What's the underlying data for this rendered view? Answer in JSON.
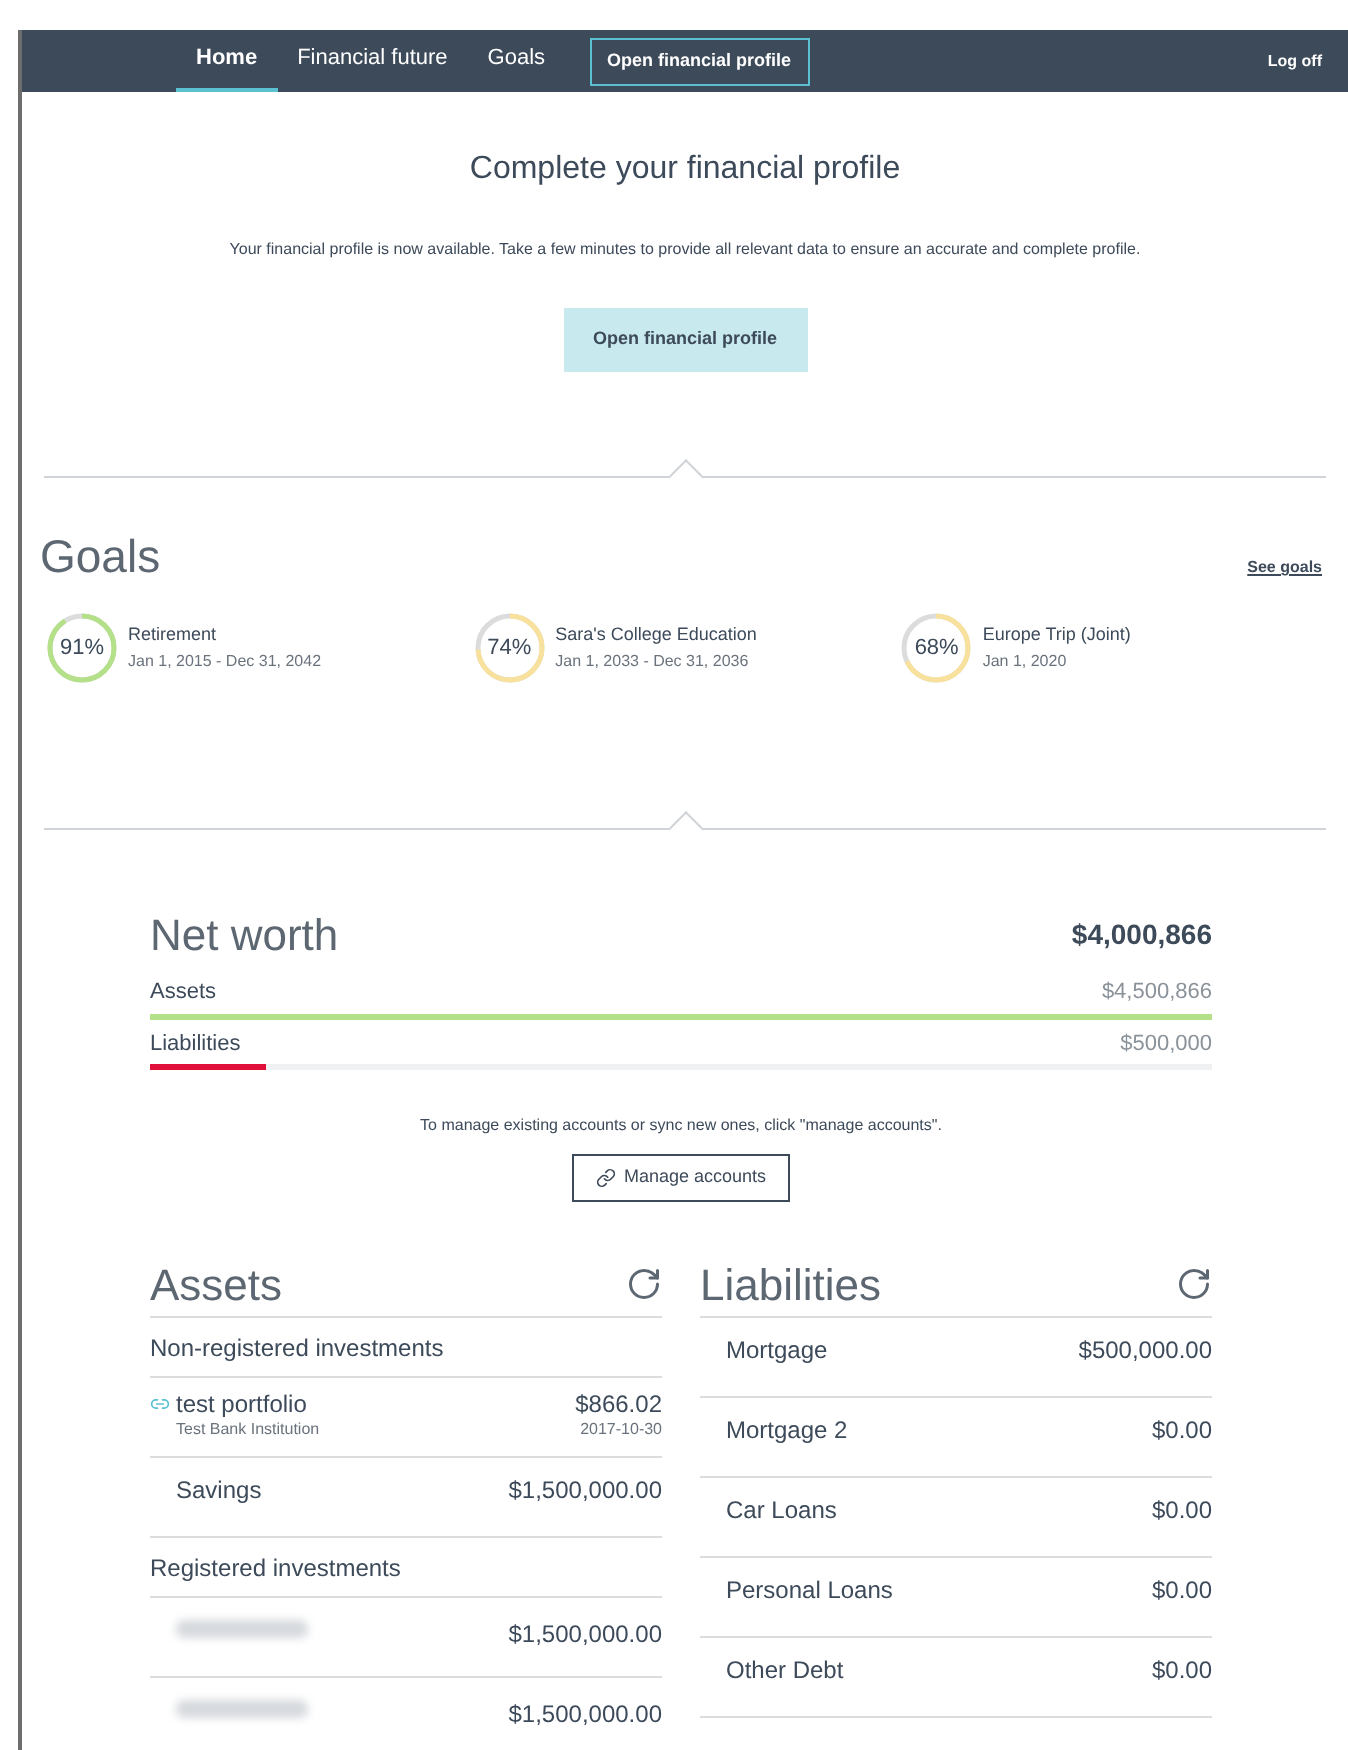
{
  "nav": {
    "tabs": [
      {
        "label": "Home",
        "selected": true
      },
      {
        "label": "Financial future",
        "selected": false
      },
      {
        "label": "Goals",
        "selected": false
      }
    ],
    "profile_button": "Open financial profile",
    "logoff": "Log off"
  },
  "profile_prompt": {
    "title": "Complete your financial profile",
    "text": "Your financial profile is now available. Take a few minutes to provide all relevant data to ensure an accurate and complete profile.",
    "button": "Open financial profile"
  },
  "goals": {
    "title": "Goals",
    "link": "See goals",
    "items": [
      {
        "percent": "91%",
        "level": 0.91,
        "color": "#b5e08a",
        "name": "Retirement",
        "dates": "Jan 1, 2015 - Dec 31, 2042"
      },
      {
        "percent": "74%",
        "level": 0.74,
        "color": "#f8e19c",
        "name": "Sara's College Education",
        "dates": "Jan 1, 2033 - Dec 31, 2036"
      },
      {
        "percent": "68%",
        "level": 0.68,
        "color": "#f8e19c",
        "name": "Europe Trip (Joint)",
        "dates": "Jan 1, 2020"
      }
    ]
  },
  "net_worth": {
    "title": "Net worth",
    "total": "$4,000,866",
    "rows": [
      {
        "label": "Assets",
        "value": "$4,500,866",
        "level": 1,
        "color": "#b5e08a"
      },
      {
        "label": "Liabilities",
        "value": "$500,000",
        "level": 0.11,
        "color": "#e0103a"
      }
    ],
    "note": "To manage existing accounts or sync new ones, click \"manage accounts\".",
    "button": "Manage accounts"
  },
  "assets": {
    "title": "Assets",
    "rows": [
      {
        "kind": "group",
        "label": "Non-registered investments"
      },
      {
        "kind": "linked",
        "label": "test portfolio",
        "sub": "Test Bank Institution",
        "value": "$866.02",
        "date": "2017-10-30"
      },
      {
        "kind": "account",
        "label": "Savings",
        "value": "$1,500,000.00"
      },
      {
        "kind": "group",
        "label": "Registered investments"
      },
      {
        "kind": "redacted",
        "value": "$1,500,000.00"
      },
      {
        "kind": "redacted",
        "value": "$1,500,000.00"
      }
    ]
  },
  "liabilities": {
    "title": "Liabilities",
    "rows": [
      {
        "label": "Mortgage",
        "value": "$500,000.00"
      },
      {
        "label": "Mortgage 2",
        "value": "$0.00"
      },
      {
        "label": "Car Loans",
        "value": "$0.00"
      },
      {
        "label": "Personal Loans",
        "value": "$0.00"
      },
      {
        "label": "Other Debt",
        "value": "$0.00"
      }
    ]
  }
}
